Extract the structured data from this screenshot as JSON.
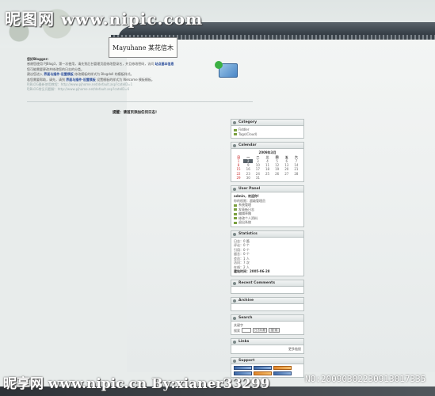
{
  "watermark": {
    "top": "昵图网 www.nipic.com",
    "bottom": "昵享网 www.nipic.cn  By:xianer33299",
    "code": "NO:20090302230913017335"
  },
  "logo": {
    "text": "Mayuhane 某花信木"
  },
  "intro": {
    "title": "您好Blogger:",
    "line1": "感谢您使用 PJBlog3，第一次使用，请先到后台管理页面修改登录名，并且修改密码，访问",
    "link_admin": "站点基本信息",
    "line2": "您可能需要更改并修改您的日志的分类。",
    "line3a": "建议您进入",
    "link_interface": "界面与插件·设置模板",
    "line3b": "修改模板的样式为 Blogdoll 的模板样式。",
    "line4a": "若您需要帮助，请先，请到",
    "link_interface2": "界面与插件·设置模板",
    "line4b": "设置模板的样式为 Welcome 模板模板。",
    "ip1": "PJBLOG最新使用教程：http://www.pjhome.net/default.asp?cateID=1",
    "ip2": "PJBLOG常见问题解：http://www.pjhome.net/default.asp?cateID=6"
  },
  "notice": "提醒：请首页添加任何日志!",
  "sidebar": {
    "category": {
      "title": "Category",
      "items": [
        "Fiddler",
        "Tags(Cloud)"
      ]
    },
    "calendar": {
      "title": "Calendar",
      "month": "2009年3月",
      "weekdays": [
        "日",
        "一",
        "二",
        "三",
        "四",
        "五",
        "六"
      ],
      "days": [
        "1",
        "2",
        "3",
        "4",
        "5",
        "6",
        "7",
        "8",
        "9",
        "10",
        "11",
        "12",
        "13",
        "14",
        "15",
        "16",
        "17",
        "18",
        "19",
        "20",
        "21",
        "22",
        "23",
        "24",
        "25",
        "26",
        "27",
        "28",
        "29",
        "30",
        "31"
      ],
      "today": "2"
    },
    "user_panel": {
      "title": "User Panel",
      "greeting": "admin，欢迎你!",
      "role": "你的权限：超级管理员",
      "items": [
        "系统管理",
        "发表新日志",
        "编辑草稿",
        "修改个人资料",
        "退出系统"
      ]
    },
    "statistics": {
      "title": "Statistics",
      "rows": [
        "日志：0 篇",
        "评论：0 个",
        "引用：0 个",
        "留言：0 个",
        "会员：1 人",
        "访问：7 次",
        "在线：2 人",
        "建站时间：2005-06-28"
      ]
    },
    "recent_comments": {
      "title": "Recent Comments"
    },
    "archive": {
      "title": "Archive"
    },
    "search": {
      "title": "Search",
      "label": "关键字",
      "field_label": "搜索",
      "option": "日志标题",
      "button": "搜 索"
    },
    "links": {
      "title": "Links",
      "more": "更多链接"
    },
    "support": {
      "title": "Support"
    }
  }
}
